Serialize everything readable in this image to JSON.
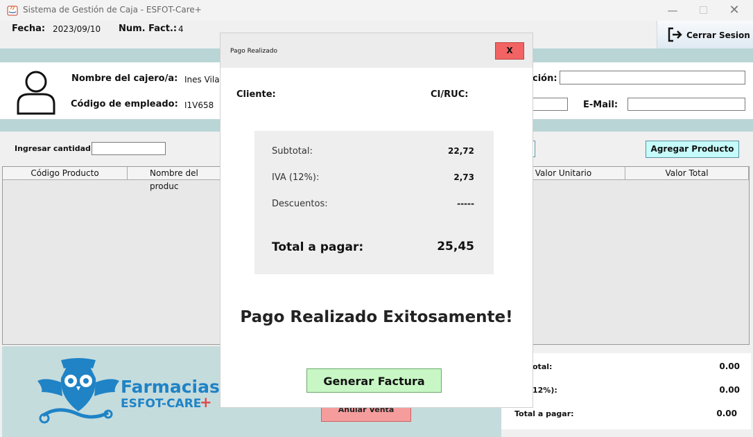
{
  "window": {
    "title": "Sistema de Gestión de Caja - ESFOT-Care+"
  },
  "header": {
    "fecha_label": "Fecha:",
    "fecha_value": "2023/09/10",
    "fact_label": "Num. Fact.:",
    "fact_value": "4",
    "logout_label": "Cerrar Sesion"
  },
  "cashier": {
    "name_label": "Nombre del cajero/a:",
    "name_value": "Ines Vilar",
    "code_label": "Código de empleado:",
    "code_value": "I1V658"
  },
  "customer": {
    "direccion_label": "ción:",
    "email_label": "E-Mail:"
  },
  "product_entry": {
    "quantity_label": "Ingresar cantidad:",
    "add_button": "Agregar Producto"
  },
  "table": {
    "headers": [
      "Código Producto",
      "Nombre del produc",
      "Valor Unitario",
      "Valor Total"
    ]
  },
  "totals": {
    "subtotal_label": "otal:",
    "subtotal_value": "0.00",
    "iva_label": "12%):",
    "iva_value": "0.00",
    "total_label": "Total a pagar:",
    "total_value": "0.00"
  },
  "cancel_button": "Anular Venta",
  "logo": {
    "line1": "Farmacias",
    "line2": "ESFOT-CARE",
    "plus": "+"
  },
  "dialog": {
    "title": "Pago Realizado",
    "close_label": "X",
    "cliente_label": "Cliente:",
    "ci_label": "CI/RUC:",
    "subtotal_label": "Subtotal:",
    "subtotal_value": "22,72",
    "iva_label": "IVA (12%):",
    "iva_value": "2,73",
    "descuentos_label": "Descuentos:",
    "descuentos_value": "-----",
    "total_label": "Total a pagar:",
    "total_value": "25,45",
    "success_message": "Pago Realizado Exitosamente!",
    "generate_button": "Generar Factura"
  },
  "colors": {
    "band": "#b9d5d6",
    "add_button": "#c6fbfb",
    "cancel_button": "#f59d9d",
    "dialog_close": "#f26363",
    "generate_button": "#c8f7c5",
    "logo_blue": "#1f83c6"
  }
}
